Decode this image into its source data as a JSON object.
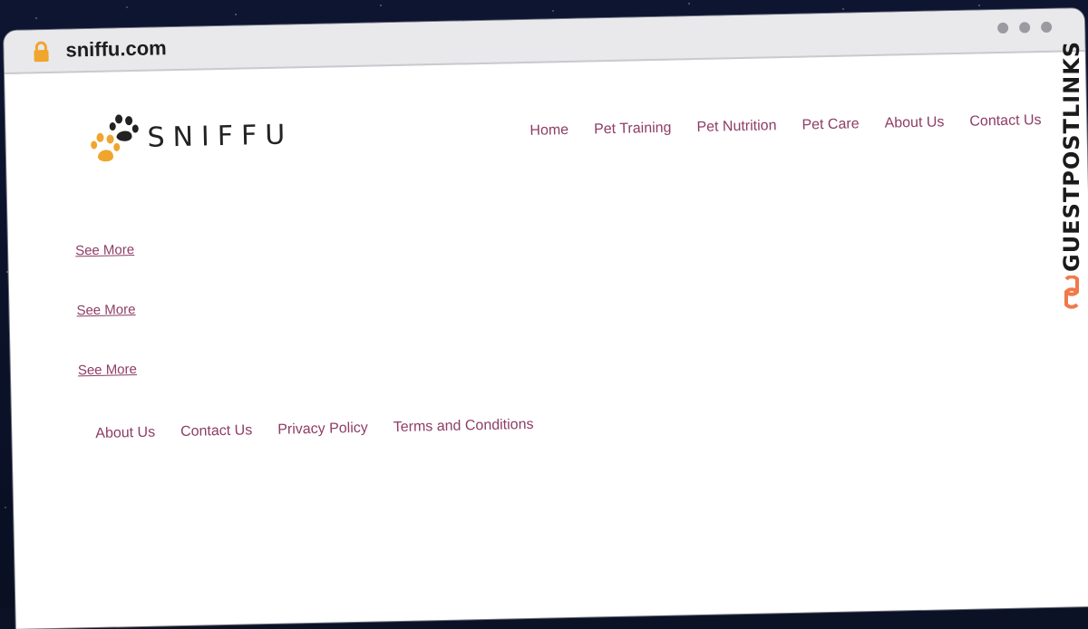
{
  "browser": {
    "domain": "sniffu.com"
  },
  "site": {
    "logo_text": "SNIFFU",
    "nav": [
      "Home",
      "Pet Training",
      "Pet Nutrition",
      "Pet Care",
      "About Us",
      "Contact Us"
    ],
    "see_more": [
      "See More",
      "See More",
      "See More"
    ],
    "footer_links": [
      "About Us",
      "Contact Us",
      "Privacy Policy",
      "Terms and Conditions"
    ]
  },
  "overlay": {
    "brand": "GUESTPOSTLINKS"
  },
  "colors": {
    "link": "#8e3d66",
    "paw_orange": "#f0a52c",
    "brand_orange": "#f07a4b"
  },
  "icons": {
    "lock": "lock-icon",
    "paw": "paw-icon",
    "link": "chain-link-icon"
  }
}
